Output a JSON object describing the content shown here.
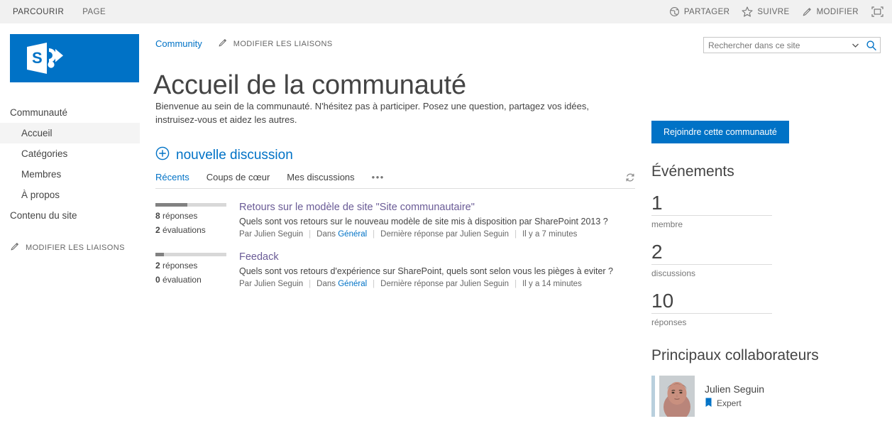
{
  "suitebar": {
    "tabs": [
      {
        "label": "PARCOURIR",
        "active": true
      },
      {
        "label": "PAGE",
        "active": false
      }
    ],
    "actions": [
      {
        "label": "PARTAGER",
        "icon": "share-icon"
      },
      {
        "label": "SUIVRE",
        "icon": "star-icon"
      },
      {
        "label": "MODIFIER",
        "icon": "pencil-icon"
      }
    ],
    "focus_icon": "focus-on-content-icon"
  },
  "sidebar": {
    "logo_icon": "sharepoint-logo",
    "heading": "Communauté",
    "items": [
      {
        "label": "Accueil",
        "selected": true
      },
      {
        "label": "Catégories",
        "selected": false
      },
      {
        "label": "Membres",
        "selected": false
      },
      {
        "label": "À propos",
        "selected": false
      }
    ],
    "site_content": "Contenu du site",
    "edit_links": "MODIFIER LES LIAISONS"
  },
  "header": {
    "breadcrumb": "Community",
    "edit_links": "MODIFIER LES LIAISONS",
    "title": "Accueil de la communauté"
  },
  "search": {
    "placeholder": "Rechercher dans ce site",
    "value": ""
  },
  "main": {
    "welcome": "Bienvenue au sein de la communauté. N'hésitez pas à participer. Posez une question, partagez vos idées, instruisez-vous et aidez les autres.",
    "new_discussion": "nouvelle discussion",
    "tabs": [
      {
        "label": "Récents",
        "active": true
      },
      {
        "label": "Coups de cœur",
        "active": false
      },
      {
        "label": "Mes discussions",
        "active": false
      }
    ],
    "tab_more": "•••",
    "discussions": [
      {
        "title": "Retours sur le modèle de site \"Site communautaire\"",
        "excerpt": "Quels sont vos retours sur le nouveau modèle de site mis à disposition par SharePoint 2013 ?",
        "replies_count": "8",
        "replies_label": "réponses",
        "ratings_count": "2",
        "ratings_label": "évaluations",
        "bar_percent": 45,
        "author_prefix": "Par",
        "author": "Julien Seguin",
        "category_prefix": "Dans",
        "category": "Général",
        "last_reply": "Dernière réponse par Julien Seguin",
        "time": "Il y a 7 minutes"
      },
      {
        "title": "Feedack",
        "excerpt": "Quels sont vos retours d'expérience sur SharePoint, quels sont selon vous les pièges à eviter ?",
        "replies_count": "2",
        "replies_label": "réponses",
        "ratings_count": "0",
        "ratings_label": "évaluation",
        "bar_percent": 12,
        "author_prefix": "Par",
        "author": "Julien Seguin",
        "category_prefix": "Dans",
        "category": "Général",
        "last_reply": "Dernière réponse par Julien Seguin",
        "time": "Il y a 14 minutes"
      }
    ]
  },
  "rightcol": {
    "join_button": "Rejoindre cette communauté",
    "events_heading": "Événements",
    "stats": [
      {
        "number": "1",
        "label": "membre"
      },
      {
        "number": "2",
        "label": "discussions"
      },
      {
        "number": "10",
        "label": "réponses"
      }
    ],
    "contributors_heading": "Principaux collaborateurs",
    "contributors": [
      {
        "name": "Julien Seguin",
        "badge": "Expert",
        "badge_icon": "ribbon-icon"
      }
    ]
  },
  "colors": {
    "accent": "#0072c6",
    "suitebar_bg": "#f1f1f1",
    "visited_link": "#6a5b96",
    "text": "#444444"
  }
}
